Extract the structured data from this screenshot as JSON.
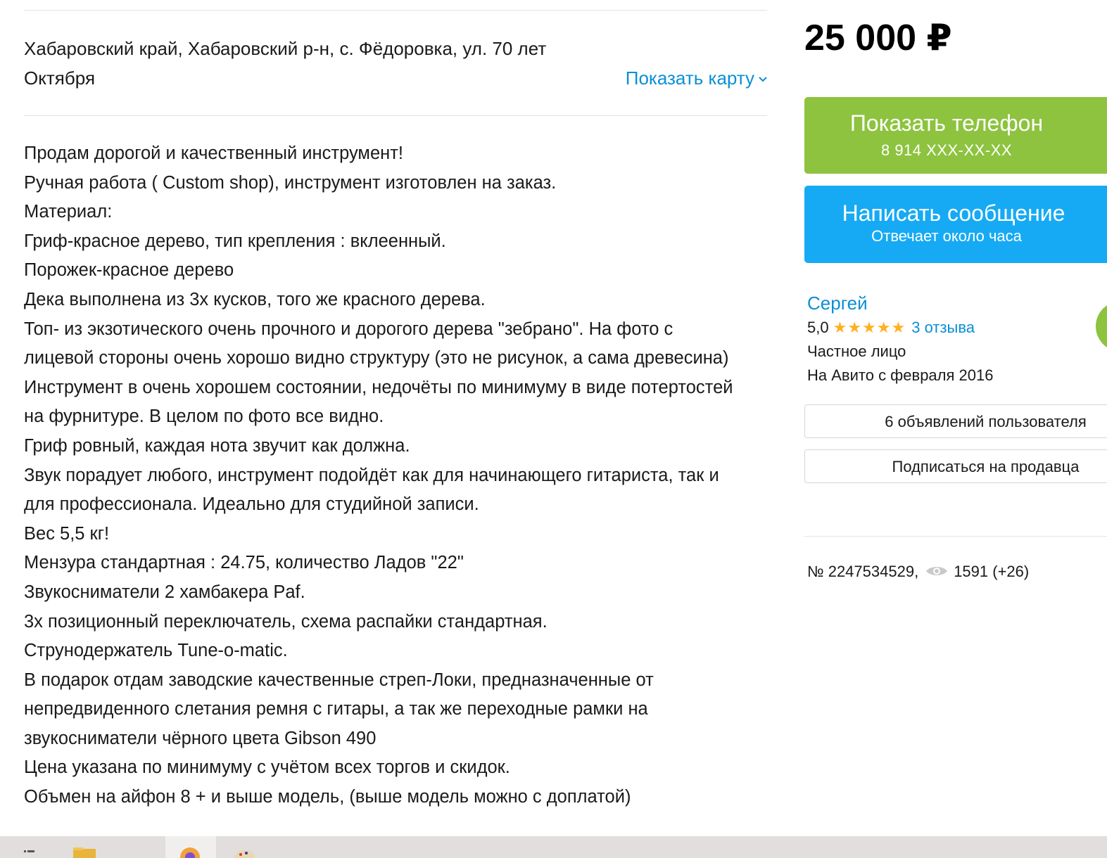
{
  "listing": {
    "address_line1": "Хабаровский край, Хабаровский р-н, с. Фёдоровка, ул. 70 лет",
    "address_line2": "Октября",
    "show_map_label": "Показать карту",
    "description_lines": [
      "Продам дорогой и качественный инструмент!",
      "Ручная работа ( Custom shop), инструмент изготовлен на заказ.",
      "Материал:",
      "Гриф-красное дерево, тип крепления : вклеенный.",
      "Порожек-красное дерево",
      "Дека выполнена из 3х кусков, того же красного дерева.",
      "Топ- из экзотического очень прочного и дорогого дерева \"зебрано\". На фото с",
      "лицевой стороны очень хорошо видно структуру (это не рисунок, а сама древесина)",
      "Инструмент в очень хорошем состоянии, недочёты по минимуму в виде потертостей",
      "на фурнитуре. В целом по фото все видно.",
      "Гриф ровный, каждая нота звучит как должна.",
      "Звук порадует любого, инструмент подойдёт как для начинающего гитариста, так и",
      "для профессионала. Идеально для студийной записи.",
      "Вес 5,5 кг!",
      "Мензура стандартная : 24.75, количество Ладов \"22\"",
      "Звукосниматели 2 хамбакера Paf.",
      "3х позиционный переключатель, схема распайки стандартная.",
      "Струнодержатель Tune-o-matic.",
      "В подарок отдам заводские качественные стреп-Локи, предназначенные от",
      "непредвиденного слетания ремня с гитары, а так же переходные рамки на",
      "звукосниматели чёрного цвета Gibson 490",
      "Цена указана по минимуму с учётом всех торгов и скидок.",
      "Объмен на айфон 8 + и выше модель, (выше модель можно с доплатой)"
    ]
  },
  "sidebar": {
    "price": "25 000 ₽",
    "phone_button": {
      "label": "Показать телефон",
      "phone": "8 914 XXX-XX-XX"
    },
    "message_button": {
      "label": "Написать сообщение",
      "sub": "Отвечает около часа"
    },
    "seller": {
      "name": "Сергей",
      "rating": "5,0",
      "rating_stars": 5,
      "reviews": "3 отзыва",
      "type": "Частное лицо",
      "since": "На Авито с февраля 2016"
    },
    "listings_button": "6 объявлений пользователя",
    "subscribe_button": "Подписаться на продавца",
    "ad_number": "№ 2247534529,",
    "views": "1591 (+26)"
  },
  "colors": {
    "accent_link": "#0a8fd6",
    "phone_button": "#8dc33f",
    "message_button": "#16aaf4",
    "stars": "#ffb021"
  },
  "icons": [
    "chevron-down-icon",
    "star-icon",
    "eye-icon",
    "avatar"
  ]
}
